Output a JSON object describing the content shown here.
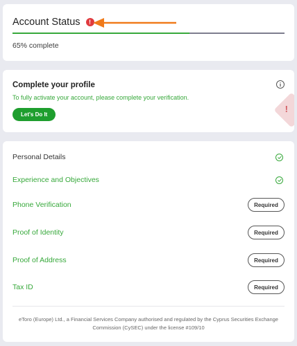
{
  "status": {
    "title": "Account Status",
    "alert_icon": "!",
    "progress_text": "65% complete",
    "progress_percent": 65,
    "progress_color": "#36a83a",
    "arrow_color": "#f07a1a"
  },
  "profile": {
    "title": "Complete your profile",
    "info_icon": "i",
    "description": "To fully activate your account, please complete your verification.",
    "cta_label": "Let's Do It"
  },
  "verification": {
    "items": [
      {
        "label": "Personal Details",
        "state": "complete"
      },
      {
        "label": "Experience and Objectives",
        "state": "complete"
      },
      {
        "label": "Phone Verification",
        "state": "required",
        "button": "Required"
      },
      {
        "label": "Proof of Identity",
        "state": "required",
        "button": "Required"
      },
      {
        "label": "Proof of Address",
        "state": "required",
        "button": "Required"
      },
      {
        "label": "Tax ID",
        "state": "required",
        "button": "Required"
      }
    ]
  },
  "footer": {
    "text": "eToro (Europe) Ltd., a Financial Services Company authorised and regulated by the Cyprus Securities Exchange Commission (CySEC) under the license #109/10"
  },
  "colors": {
    "accent_green": "#36a83a",
    "button_green": "#1e9e2e",
    "alert_red": "#e03a3e",
    "background": "#e9eaf0"
  }
}
